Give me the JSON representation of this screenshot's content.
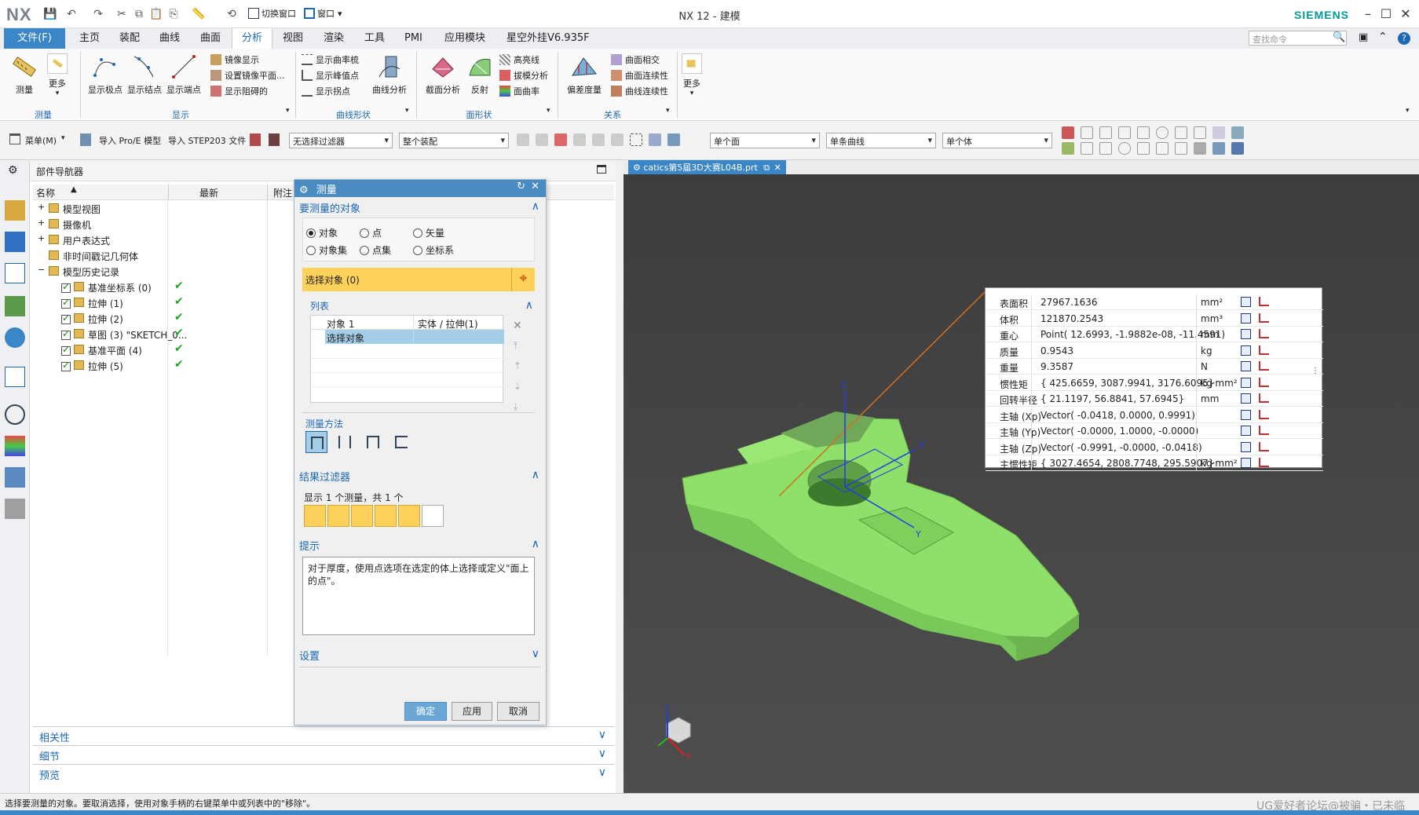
{
  "app": {
    "title": "NX 12 - 建模",
    "brand": "SIEMENS",
    "logo": "NX"
  },
  "quick_access": {
    "switch_window": "切换窗口",
    "window": "窗口"
  },
  "menu": {
    "file": "文件(F)",
    "tabs": [
      "主页",
      "装配",
      "曲线",
      "曲面",
      "分析",
      "视图",
      "渲染",
      "工具",
      "PMI",
      "应用模块",
      "星空外挂V6.935F"
    ],
    "active_tab": "分析",
    "search_placeholder": "查找命令"
  },
  "ribbon": {
    "measure": {
      "items": [
        "测量",
        "更多"
      ],
      "group": "测量"
    },
    "display": {
      "big": [
        "显示极点",
        "显示结点",
        "显示端点"
      ],
      "small": [
        "镜像显示",
        "设置镜像平面...",
        "显示阻碍的"
      ],
      "group": "显示"
    },
    "curve_shape": {
      "small": [
        "显示曲率梳",
        "显示峰值点",
        "显示拐点"
      ],
      "big": "曲线分析",
      "group": "曲线形状"
    },
    "face_shape": {
      "big": [
        "截面分析",
        "反射"
      ],
      "small": [
        "高亮线",
        "拔模分析",
        "面曲率"
      ],
      "group": "面形状"
    },
    "relation": {
      "big": "偏差度量",
      "small": [
        "曲面相交",
        "曲面连续性",
        "曲线连续性"
      ],
      "group": "关系"
    },
    "more": "更多"
  },
  "toolbar2": {
    "menu": "菜单(M)",
    "import_proe": "导入 Pro/E 模型",
    "import_step": "导入 STEP203 文件",
    "filter": "无选择过滤器",
    "assembly": "整个装配",
    "face": "单个面",
    "curve": "单条曲线",
    "body": "单个体"
  },
  "navigator": {
    "title": "部件导航器",
    "columns": [
      "名称",
      "最新",
      "附注"
    ],
    "rows": [
      {
        "name": "模型视图",
        "level": 0,
        "expand": "+",
        "check": false,
        "latest": false
      },
      {
        "name": "摄像机",
        "level": 0,
        "expand": "+",
        "check": false,
        "latest": false
      },
      {
        "name": "用户表达式",
        "level": 0,
        "expand": "+",
        "check": false,
        "latest": false
      },
      {
        "name": "非时间戳记几何体",
        "level": 0,
        "expand": "",
        "check": false,
        "latest": false
      },
      {
        "name": "模型历史记录",
        "level": 0,
        "expand": "−",
        "check": false,
        "latest": false
      },
      {
        "name": "基准坐标系 (0)",
        "level": 1,
        "expand": "",
        "check": true,
        "latest": true
      },
      {
        "name": "拉伸 (1)",
        "level": 1,
        "expand": "",
        "check": true,
        "latest": true
      },
      {
        "name": "拉伸 (2)",
        "level": 1,
        "expand": "",
        "check": true,
        "latest": true
      },
      {
        "name": "草图 (3) \"SKETCH_0...",
        "level": 1,
        "expand": "",
        "check": true,
        "latest": true
      },
      {
        "name": "基准平面 (4)",
        "level": 1,
        "expand": "",
        "check": true,
        "latest": true
      },
      {
        "name": "拉伸 (5)",
        "level": 1,
        "expand": "",
        "check": true,
        "latest": true
      }
    ],
    "panels": [
      "相关性",
      "细节",
      "预览"
    ]
  },
  "dialog": {
    "title": "测量",
    "section_object": "要测量的对象",
    "radios": [
      "对象",
      "点",
      "矢量",
      "对象集",
      "点集",
      "坐标系"
    ],
    "selected_radio": "对象",
    "select_label": "选择对象 (0)",
    "list_label": "列表",
    "list_rows": [
      [
        "对象 1",
        "实体 / 拉伸(1)"
      ],
      [
        "选择对象",
        ""
      ]
    ],
    "method_label": "测量方法",
    "section_filter": "结果过滤器",
    "filter_text": "显示 1 个测量，共 1 个",
    "section_hint": "提示",
    "hint_text": "对于厚度，使用点选项在选定的体上选择或定义\"面上的点\"。",
    "section_settings": "设置",
    "ok": "确定",
    "apply": "应用",
    "cancel": "取消"
  },
  "viewport": {
    "tab": "catics第5届3D大赛L04B.prt",
    "results": [
      {
        "label": "表面积",
        "value": "27967.1636",
        "unit": "mm²"
      },
      {
        "label": "体积",
        "value": "121870.2543",
        "unit": "mm³"
      },
      {
        "label": "重心",
        "value": "Point( 12.6993, -1.9882e-08, -11.4591)",
        "unit": "mm"
      },
      {
        "label": "质量",
        "value": "0.9543",
        "unit": "kg"
      },
      {
        "label": "重量",
        "value": "9.3587",
        "unit": "N"
      },
      {
        "label": "惯性矩",
        "value": "{ 425.6659, 3087.9941, 3176.6095}",
        "unit": "kg·mm²"
      },
      {
        "label": "回转半径",
        "value": "{ 21.1197, 56.8841, 57.6945}",
        "unit": "mm"
      },
      {
        "label": "主轴 (Xp)",
        "value": "Vector( -0.0418, 0.0000, 0.9991)",
        "unit": ""
      },
      {
        "label": "主轴 (Yp)",
        "value": "Vector( -0.0000, 1.0000, -0.0000)",
        "unit": ""
      },
      {
        "label": "主轴 (Zp)",
        "value": "Vector( -0.9991, -0.0000, -0.0418)",
        "unit": ""
      },
      {
        "label": "主惯性矩",
        "value": "{ 3027.4654, 2808.7748, 295.5907}",
        "unit": "kg·mm²"
      }
    ]
  },
  "status": "选择要测量的对象。要取消选择，使用对象手柄的右键菜单中或列表中的\"移除\"。",
  "watermark": "UG爱好者论坛@被骗・已未临",
  "colors": {
    "accent": "#3b86c6",
    "part": "#8ee06a",
    "select": "#fed15b"
  }
}
